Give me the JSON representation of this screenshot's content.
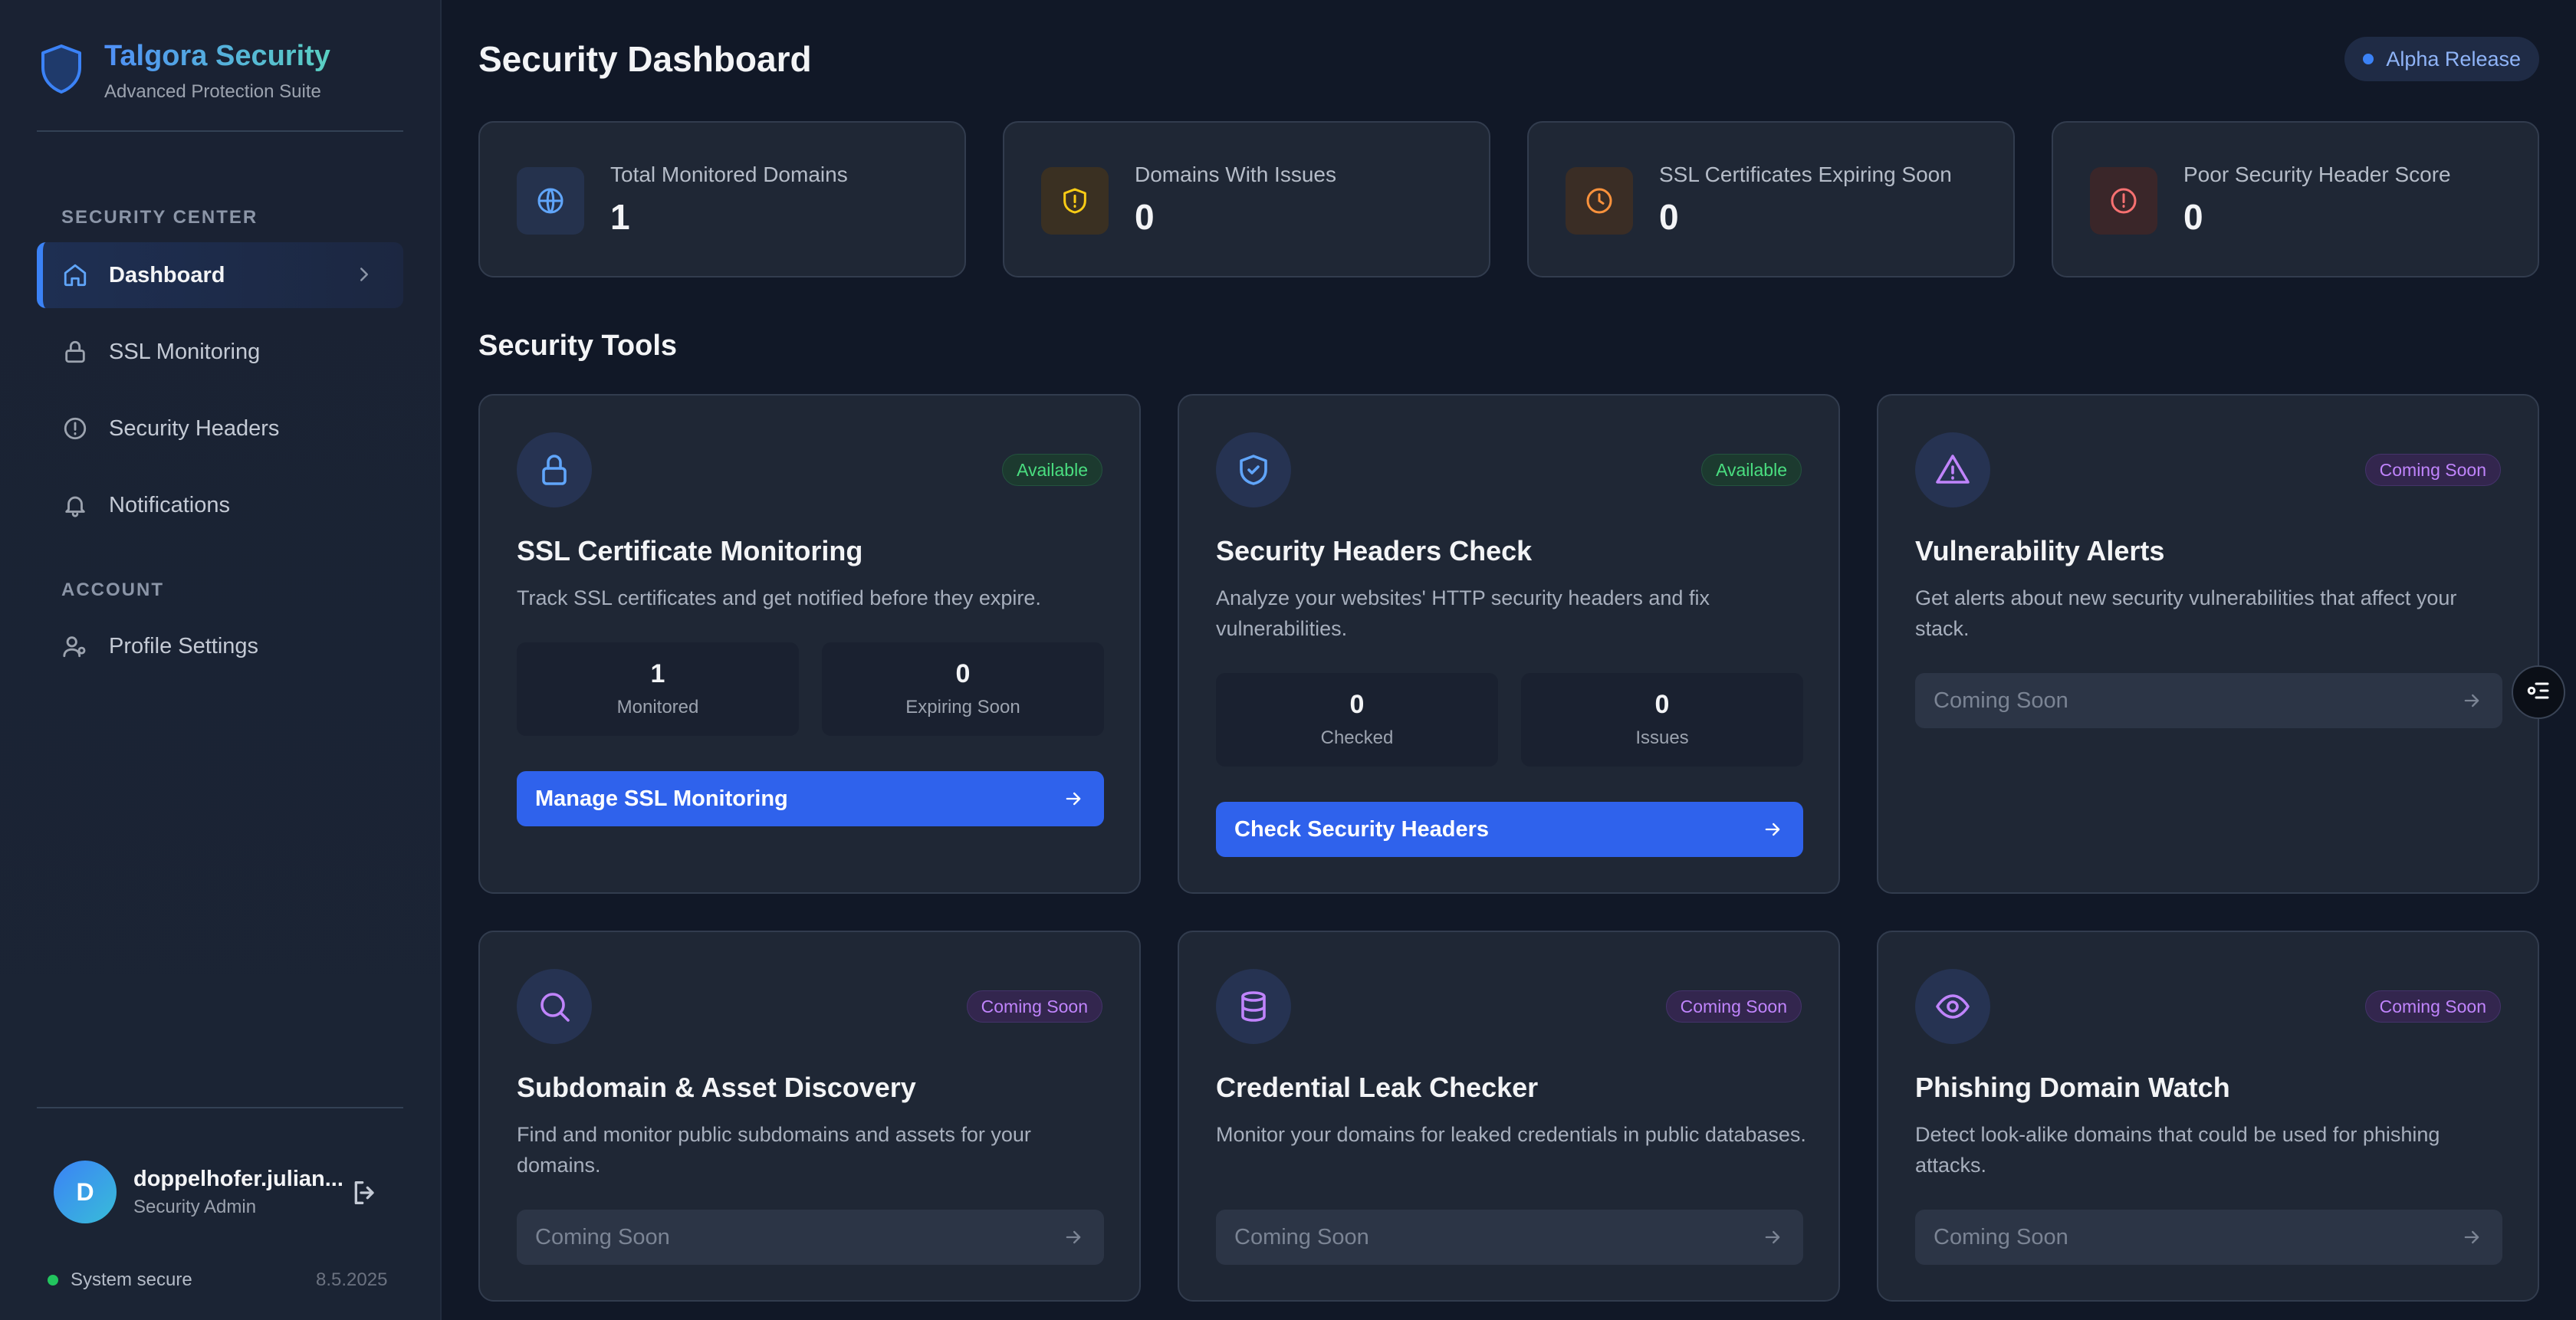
{
  "brand": {
    "title": "Talgora Security",
    "subtitle": "Advanced Protection Suite"
  },
  "sidebar": {
    "sections": [
      {
        "label": "SECURITY CENTER"
      },
      {
        "label": "ACCOUNT"
      }
    ],
    "items": [
      {
        "label": "Dashboard",
        "icon": "home-icon",
        "active": true
      },
      {
        "label": "SSL Monitoring",
        "icon": "lock-icon"
      },
      {
        "label": "Security Headers",
        "icon": "alert-circle-icon"
      },
      {
        "label": "Notifications",
        "icon": "bell-icon"
      },
      {
        "label": "Profile Settings",
        "icon": "user-settings-icon"
      }
    ]
  },
  "user": {
    "initial": "D",
    "name": "doppelhofer.julian...",
    "role": "Security Admin"
  },
  "system": {
    "status": "System secure",
    "date": "8.5.2025"
  },
  "header": {
    "title": "Security Dashboard",
    "release_badge": "Alpha Release"
  },
  "stats": [
    {
      "label": "Total Monitored Domains",
      "value": "1",
      "icon": "globe-icon",
      "color": "#60a5fa"
    },
    {
      "label": "Domains With Issues",
      "value": "0",
      "icon": "shield-alert-icon",
      "color": "#facc15"
    },
    {
      "label": "SSL Certificates Expiring Soon",
      "value": "0",
      "icon": "clock-icon",
      "color": "#fb923c"
    },
    {
      "label": "Poor Security Header Score",
      "value": "0",
      "icon": "alert-circle-icon",
      "color": "#f87171"
    }
  ],
  "tools_section": {
    "title": "Security Tools"
  },
  "tools": [
    {
      "title": "SSL Certificate Monitoring",
      "badge": "Available",
      "description": "Track SSL certificates and get notified before they expire.",
      "stats": [
        {
          "value": "1",
          "label": "Monitored"
        },
        {
          "value": "0",
          "label": "Expiring Soon"
        }
      ],
      "button": "Manage SSL Monitoring",
      "icon": "lock-icon"
    },
    {
      "title": "Security Headers Check",
      "badge": "Available",
      "description": "Analyze your websites' HTTP security headers and fix vulnerabilities.",
      "stats": [
        {
          "value": "0",
          "label": "Checked"
        },
        {
          "value": "0",
          "label": "Issues"
        }
      ],
      "button": "Check Security Headers",
      "icon": "shield-check-icon"
    },
    {
      "title": "Vulnerability Alerts",
      "badge": "Coming Soon",
      "description": "Get alerts about new security vulnerabilities that affect your stack.",
      "button": "Coming Soon",
      "icon": "warning-triangle-icon"
    },
    {
      "title": "Subdomain & Asset Discovery",
      "badge": "Coming Soon",
      "description": "Find and monitor public subdomains and assets for your domains.",
      "button": "Coming Soon",
      "icon": "search-icon"
    },
    {
      "title": "Credential Leak Checker",
      "badge": "Coming Soon",
      "description": "Monitor your domains for leaked credentials in public databases.",
      "button": "Coming Soon",
      "icon": "database-icon"
    },
    {
      "title": "Phishing Domain Watch",
      "badge": "Coming Soon",
      "description": "Detect look-alike domains that could be used for phishing attacks.",
      "button": "Coming Soon",
      "icon": "eye-icon"
    }
  ],
  "colors": {
    "accent": "#3b82f6",
    "primary_button": "#2f62ec",
    "available": "#4ade80",
    "coming_soon": "#c084fc"
  }
}
